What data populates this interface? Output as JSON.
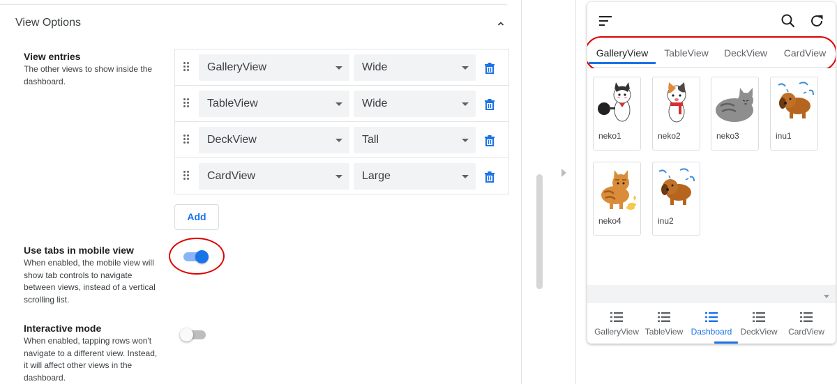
{
  "section": {
    "title": "View Options"
  },
  "view_entries": {
    "label": "View entries",
    "description": "The other views to show inside the dashboard.",
    "rows": [
      {
        "view": "GalleryView",
        "size": "Wide"
      },
      {
        "view": "TableView",
        "size": "Wide"
      },
      {
        "view": "DeckView",
        "size": "Tall"
      },
      {
        "view": "CardView",
        "size": "Large"
      }
    ],
    "add_label": "Add"
  },
  "mobile_tabs": {
    "label": "Use tabs in mobile view",
    "description": "When enabled, the mobile view will show tab controls to navigate between views, instead of a vertical scrolling list.",
    "enabled": true
  },
  "interactive_mode": {
    "label": "Interactive mode",
    "description": "When enabled, tapping rows won't navigate to a different view. Instead, it will affect other views in the dashboard.",
    "enabled": false
  },
  "preview": {
    "tabs": [
      "GalleryView",
      "TableView",
      "DeckView",
      "CardView"
    ],
    "active_tab": "GalleryView",
    "gallery": [
      {
        "caption": "neko1",
        "image": "cat-with-frying-pan"
      },
      {
        "caption": "neko2",
        "image": "calico-cat-with-scarf"
      },
      {
        "caption": "neko3",
        "image": "gray-tabby-cat-lying"
      },
      {
        "caption": "inu1",
        "image": "brown-dog-shaking"
      },
      {
        "caption": "neko4",
        "image": "orange-cat-with-coins"
      },
      {
        "caption": "inu2",
        "image": "brown-dog-shaking"
      }
    ],
    "bottom_nav": [
      "GalleryView",
      "TableView",
      "Dashboard",
      "DeckView",
      "CardView"
    ],
    "active_nav": "Dashboard"
  },
  "colors": {
    "accent": "#1a73e8",
    "highlight": "#e00000"
  }
}
